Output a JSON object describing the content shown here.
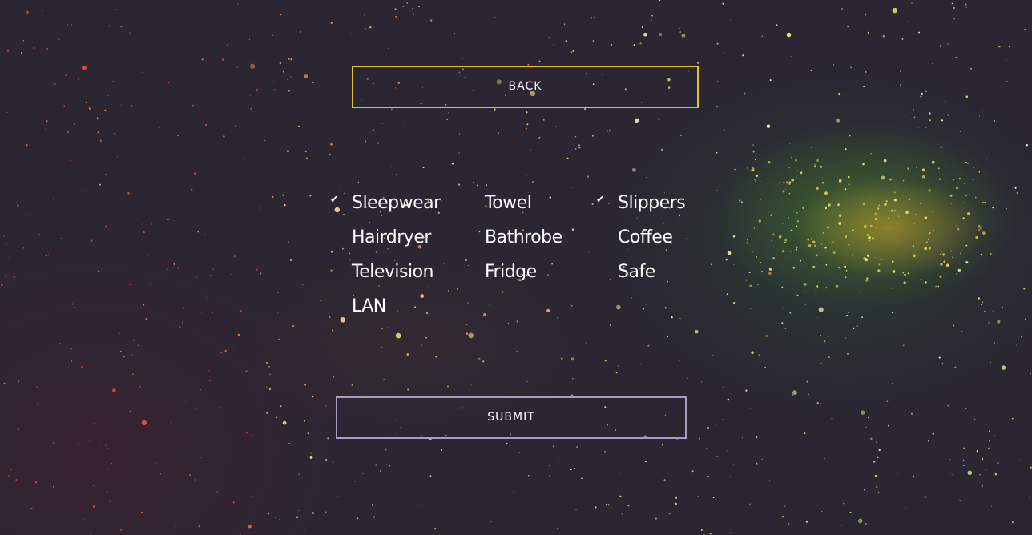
{
  "back_button": {
    "label": "BACK",
    "border_color": "#e6c229"
  },
  "submit_button": {
    "label": "SUBMIT",
    "border_color": "#a89bc4"
  },
  "check_glyph": "✔",
  "background_color": "#2a2733",
  "amenities": [
    {
      "label": "Sleepwear",
      "checked": true
    },
    {
      "label": "Towel",
      "checked": false
    },
    {
      "label": "Slippers",
      "checked": true
    },
    {
      "label": "Hairdryer",
      "checked": false
    },
    {
      "label": "Bathrobe",
      "checked": false
    },
    {
      "label": "Coffee",
      "checked": false
    },
    {
      "label": "Television",
      "checked": false
    },
    {
      "label": "Fridge",
      "checked": false
    },
    {
      "label": "Safe",
      "checked": false
    },
    {
      "label": "LAN",
      "checked": false
    }
  ]
}
